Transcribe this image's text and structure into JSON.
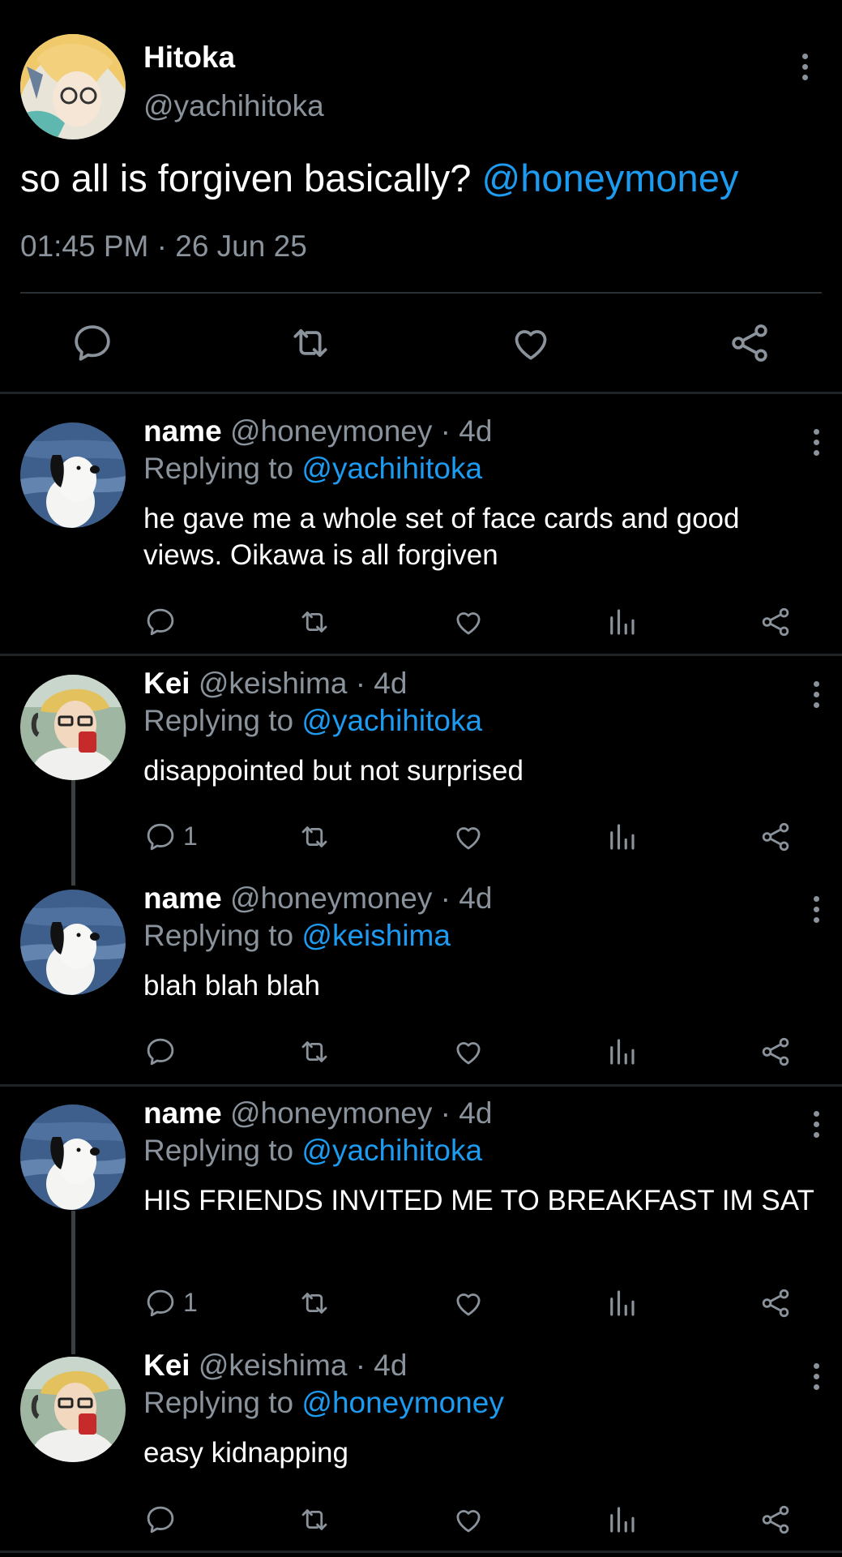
{
  "main_tweet": {
    "display_name": "Hitoka",
    "handle": "@yachihitoka",
    "text_plain": "so all is forgiven basically? ",
    "mention": "@honeymoney",
    "timestamp": "01:45 PM · 26 Jun 25",
    "actions": [
      "reply-icon",
      "retweet-icon",
      "like-icon",
      "share-icon"
    ]
  },
  "replies": [
    {
      "display_name": "name",
      "handle": "@honeymoney",
      "age": "· 4d",
      "replying_prefix": "Replying to ",
      "replying_to": "@yachihitoka",
      "text": "he gave me a whole set of face cards and good views. Oikawa is all forgiven",
      "reply_count": ""
    },
    {
      "display_name": "Kei",
      "handle": "@keishima",
      "age": "· 4d",
      "replying_prefix": "Replying to ",
      "replying_to": "@yachihitoka",
      "text": "disappointed but not surprised",
      "reply_count": "1"
    },
    {
      "display_name": "name",
      "handle": "@honeymoney",
      "age": "· 4d",
      "replying_prefix": "Replying to ",
      "replying_to": "@keishima",
      "text": "blah blah blah",
      "reply_count": ""
    },
    {
      "display_name": "name",
      "handle": "@honeymoney",
      "age": "· 4d",
      "replying_prefix": "Replying to ",
      "replying_to": "@yachihitoka",
      "text": "HIS FRIENDS INVITED ME TO BREAKFAST IM SAT",
      "reply_count": "1"
    },
    {
      "display_name": "Kei",
      "handle": "@keishima",
      "age": "· 4d",
      "replying_prefix": "Replying to ",
      "replying_to": "@honeymoney",
      "text": "easy kidnapping",
      "reply_count": ""
    }
  ],
  "colors": {
    "background": "#000000",
    "link": "#1d9bf0",
    "muted": "#8a939c",
    "divider": "#2a2f33"
  }
}
